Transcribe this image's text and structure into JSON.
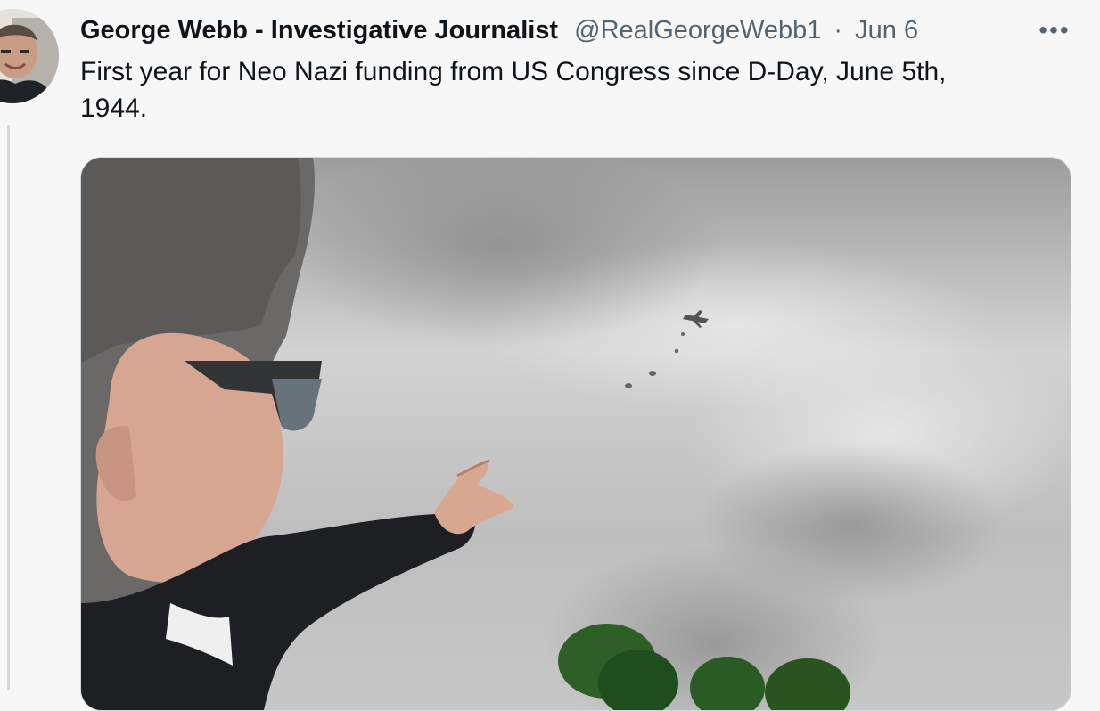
{
  "tweet": {
    "author_name": "George Webb - Investigative Journalist",
    "handle": "@RealGeorgeWebb1",
    "separator": "·",
    "date": "Jun 6",
    "more_label": "•••",
    "text": "First year for Neo Nazi funding from US Congress since D-Day, June 5th,\n1944."
  },
  "icons": {
    "more": "more-options-icon",
    "avatar": "profile-avatar",
    "media": "video-thumbnail"
  },
  "colors": {
    "background": "#f7f7f7",
    "name": "#0f1419",
    "meta": "#536471",
    "thread": "#cfd9de"
  }
}
